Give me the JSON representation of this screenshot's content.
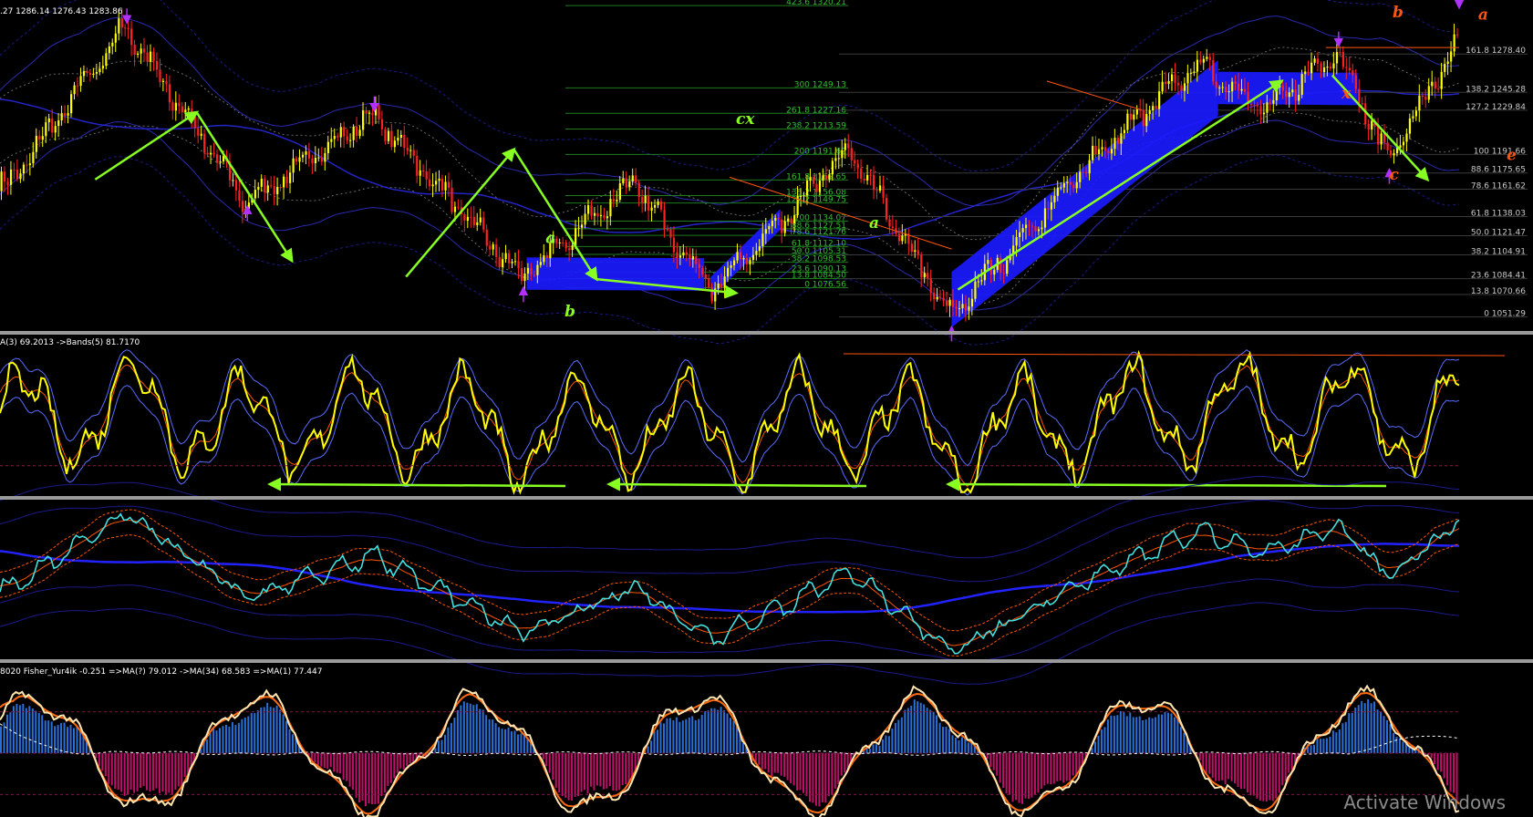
{
  "window": {
    "watermark": "Activate Windows"
  },
  "colors": {
    "background": "#000000",
    "separator": "#9a9a9a",
    "candle_bull": "#ffff00",
    "candle_bear": "#ff2222",
    "wave_arrow": "#88ff22",
    "channel_fill": "#1a1aff",
    "fib_line": "#1f7a1f",
    "fib_text": "#2fbf2f",
    "right_fib_text": "#c8c8c8",
    "envelope": "#1a1a8c",
    "envelope_inner": "#6a6a6a",
    "osc_main": "#ffff00",
    "osc_signal": "#ff5500",
    "osc_band": "#5a6cff",
    "cyan_line": "#44e0e0",
    "ma_slow": "#2222ff",
    "hist_pos": "#2a70d8",
    "hist_neg": "#c0106a",
    "fisher": "#ffe6b0",
    "fisher_ma": "#ff6a10",
    "fisher_slow": "#ffffff",
    "label_orange": "#ff5511",
    "fractal_up": "#b030ff",
    "fractal_down": "#b030ff"
  },
  "panels": {
    "price": {
      "title": ".27 1286.14 1276.43 1283.86"
    },
    "osc1": {
      "title": "A(3) 69.2013  ->Bands(5) 81.7170"
    },
    "osc3": {
      "title": "8020  Fisher_Yur4ik -0.251  =>MA(?) 79.012  ->MA(34) 68.583  =>MA(1) 77.447"
    }
  },
  "chart_data": [
    {
      "type": "candlestick",
      "panel": "price",
      "ylim": [
        1040,
        1325
      ],
      "right_fib_levels": [
        {
          "label": "161.8 1278.40",
          "value": 1278.4
        },
        {
          "label": "138.2 1245.28",
          "value": 1245.28
        },
        {
          "label": "127.2 1229.84",
          "value": 1229.84
        },
        {
          "label": "100 1191.66",
          "value": 1191.66
        },
        {
          "label": "88.6 1175.65",
          "value": 1175.65
        },
        {
          "label": "78.6 1161.62",
          "value": 1161.62
        },
        {
          "label": "61.8 1138.03",
          "value": 1138.03
        },
        {
          "label": "50.0 1121.47",
          "value": 1121.47
        },
        {
          "label": "38.2 1104.91",
          "value": 1104.91
        },
        {
          "label": "23.6 1084.41",
          "value": 1084.41
        },
        {
          "label": "13.8 1070.66",
          "value": 1070.66
        },
        {
          "label": "0 1051.29",
          "value": 1051.29
        }
      ],
      "middle_fib_levels": [
        {
          "label": "423.6 1320.21",
          "value": 1320.21
        },
        {
          "label": "300 1249.13",
          "value": 1249.13
        },
        {
          "label": "261.8 1227.16",
          "value": 1227.16
        },
        {
          "label": "238.2 1213.59",
          "value": 1213.59
        },
        {
          "label": "200 1191.62",
          "value": 1191.62
        },
        {
          "label": "161.8 1169.65",
          "value": 1169.65
        },
        {
          "label": "138.2 1156.08",
          "value": 1156.08
        },
        {
          "label": "127.2 1149.75",
          "value": 1149.75
        },
        {
          "label": "100 1134.07",
          "value": 1134.07
        },
        {
          "label": "88.6 1127.51",
          "value": 1127.51
        },
        {
          "label": "78.6 1121.76",
          "value": 1121.76
        },
        {
          "label": "61.8 1112.10",
          "value": 1112.1
        },
        {
          "label": "50.0 1105.31",
          "value": 1105.31
        },
        {
          "label": "38.2 1098.53",
          "value": 1098.53
        },
        {
          "label": "23.6 1090.13",
          "value": 1090.13
        },
        {
          "label": "13.8 1084.50",
          "value": 1084.5
        },
        {
          "label": "0 1076.56",
          "value": 1076.56
        }
      ],
      "wave_labels": [
        {
          "text": "a",
          "color": "#88ff22"
        },
        {
          "text": "b",
          "color": "#88ff22"
        },
        {
          "text": "cx",
          "color": "#88ff22"
        },
        {
          "text": "a",
          "color": "#88ff22"
        },
        {
          "text": "b",
          "color": "#ff5511"
        },
        {
          "text": "a",
          "color": "#ff5511"
        },
        {
          "text": "x",
          "color": "#ff5511"
        },
        {
          "text": "c",
          "color": "#ff5511"
        },
        {
          "text": "e",
          "color": "#ff5511"
        }
      ],
      "swing_points": [
        {
          "bar": 3,
          "price": 1165
        },
        {
          "bar": 40,
          "price": 1302
        },
        {
          "bar": 78,
          "price": 1150
        },
        {
          "bar": 118,
          "price": 1226
        },
        {
          "bar": 165,
          "price": 1085
        },
        {
          "bar": 200,
          "price": 1168
        },
        {
          "bar": 225,
          "price": 1075
        },
        {
          "bar": 268,
          "price": 1195
        },
        {
          "bar": 300,
          "price": 1052
        },
        {
          "bar": 345,
          "price": 1188
        },
        {
          "bar": 378,
          "price": 1270
        },
        {
          "bar": 400,
          "price": 1230
        },
        {
          "bar": 422,
          "price": 1282
        },
        {
          "bar": 438,
          "price": 1188
        },
        {
          "bar": 460,
          "price": 1285
        }
      ],
      "bars": 460
    },
    {
      "type": "line",
      "panel": "osc1",
      "ylim": [
        0,
        100
      ],
      "levels": [
        20,
        80
      ],
      "bars": 460
    },
    {
      "type": "line",
      "panel": "osc2",
      "ylim": [
        0,
        100
      ],
      "bars": 460
    },
    {
      "type": "bar",
      "panel": "osc3",
      "ylim": [
        -1,
        1
      ],
      "bars": 460
    }
  ]
}
